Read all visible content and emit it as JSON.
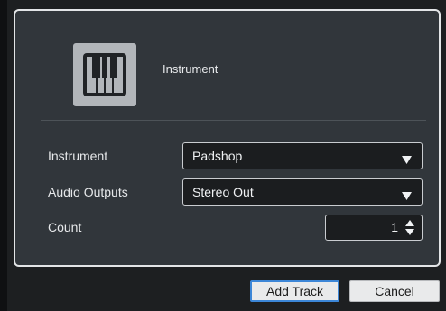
{
  "header": {
    "title": "Instrument",
    "icon": "piano-keys-icon"
  },
  "form": {
    "instrument": {
      "label": "Instrument",
      "value": "Padshop"
    },
    "audio_outputs": {
      "label": "Audio Outputs",
      "value": "Stereo Out"
    },
    "count": {
      "label": "Count",
      "value": "1"
    }
  },
  "buttons": {
    "add_track": "Add Track",
    "cancel": "Cancel"
  },
  "colors": {
    "panel": "#31363b",
    "field": "#1b1d1f",
    "focus": "#3c86d7"
  }
}
